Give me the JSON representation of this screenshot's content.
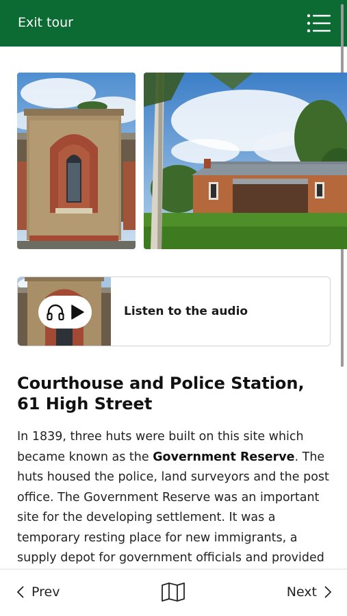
{
  "header": {
    "exit_label": "Exit tour",
    "menu_icon": "hamburger-list-icon",
    "bar_color": "#0b6b33"
  },
  "gallery": {
    "photos": [
      "courthouse-facade-photo",
      "police-station-building-photo"
    ]
  },
  "audio": {
    "label": "Listen to the audio",
    "icons": [
      "headphones-icon",
      "play-icon"
    ]
  },
  "article": {
    "title": "Courthouse and Police Station, 61 High Street",
    "body_part1": "In 1839, three huts were built on this site which became known as the ",
    "body_bold": "Government Reserve",
    "body_part2": ". The huts housed the police, land surveyors and the post office. The Government Reserve was an important site for the developing settlement. It was a temporary resting place for new immigrants, a supply depot for government officials and provided"
  },
  "footer": {
    "prev_label": "Prev",
    "next_label": "Next",
    "map_icon": "map-icon"
  }
}
